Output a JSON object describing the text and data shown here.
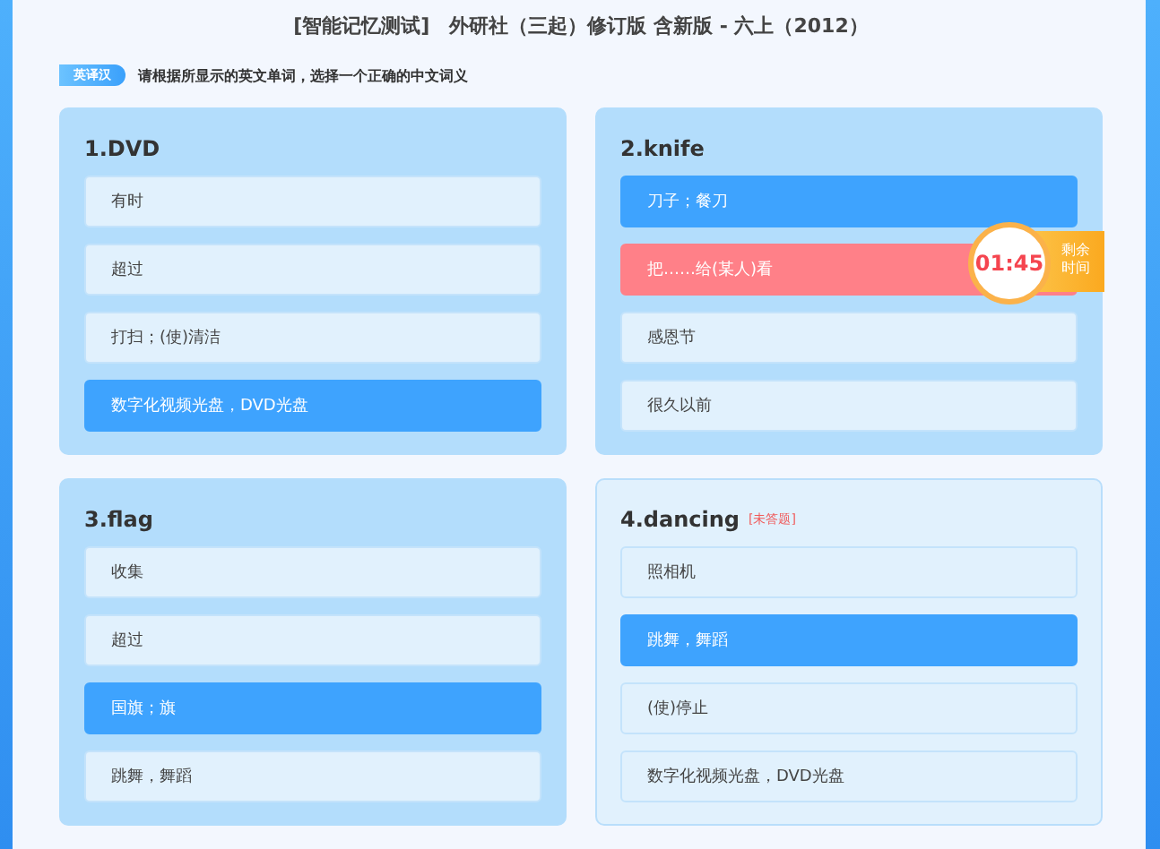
{
  "title": "[智能记忆测试]　外研社（三起）修订版 含新版 - 六上（2012）",
  "mode_badge": "英译汉",
  "instruction": "请根据所显示的英文单词，选择一个正确的中文词义",
  "questions": [
    {
      "title": "1.DVD",
      "answered": true,
      "options": [
        {
          "text": "有时",
          "selected": false,
          "wrong": false
        },
        {
          "text": "超过",
          "selected": false,
          "wrong": false
        },
        {
          "text": "打扫；(使)清洁",
          "selected": false,
          "wrong": false
        },
        {
          "text": "数字化视频光盘，DVD光盘",
          "selected": true,
          "wrong": false
        }
      ]
    },
    {
      "title": "2.knife",
      "answered": true,
      "options": [
        {
          "text": "刀子；餐刀",
          "selected": true,
          "wrong": false
        },
        {
          "text": "把……给(某人)看",
          "selected": false,
          "wrong": true
        },
        {
          "text": "感恩节",
          "selected": false,
          "wrong": false
        },
        {
          "text": "很久以前",
          "selected": false,
          "wrong": false
        }
      ]
    },
    {
      "title": "3.flag",
      "answered": true,
      "options": [
        {
          "text": "收集",
          "selected": false,
          "wrong": false
        },
        {
          "text": "超过",
          "selected": false,
          "wrong": false
        },
        {
          "text": "国旗；旗",
          "selected": true,
          "wrong": false
        },
        {
          "text": "跳舞，舞蹈",
          "selected": false,
          "wrong": false
        }
      ]
    },
    {
      "title": "4.dancing",
      "answered": false,
      "tag": "[未答题]",
      "options": [
        {
          "text": "照相机",
          "selected": false,
          "wrong": false
        },
        {
          "text": "跳舞，舞蹈",
          "selected": true,
          "wrong": false
        },
        {
          "text": "(使)停止",
          "selected": false,
          "wrong": false
        },
        {
          "text": "数字化视频光盘，DVD光盘",
          "selected": false,
          "wrong": false
        }
      ]
    }
  ],
  "timer": {
    "time": "01:45",
    "label": "剩余时间"
  }
}
